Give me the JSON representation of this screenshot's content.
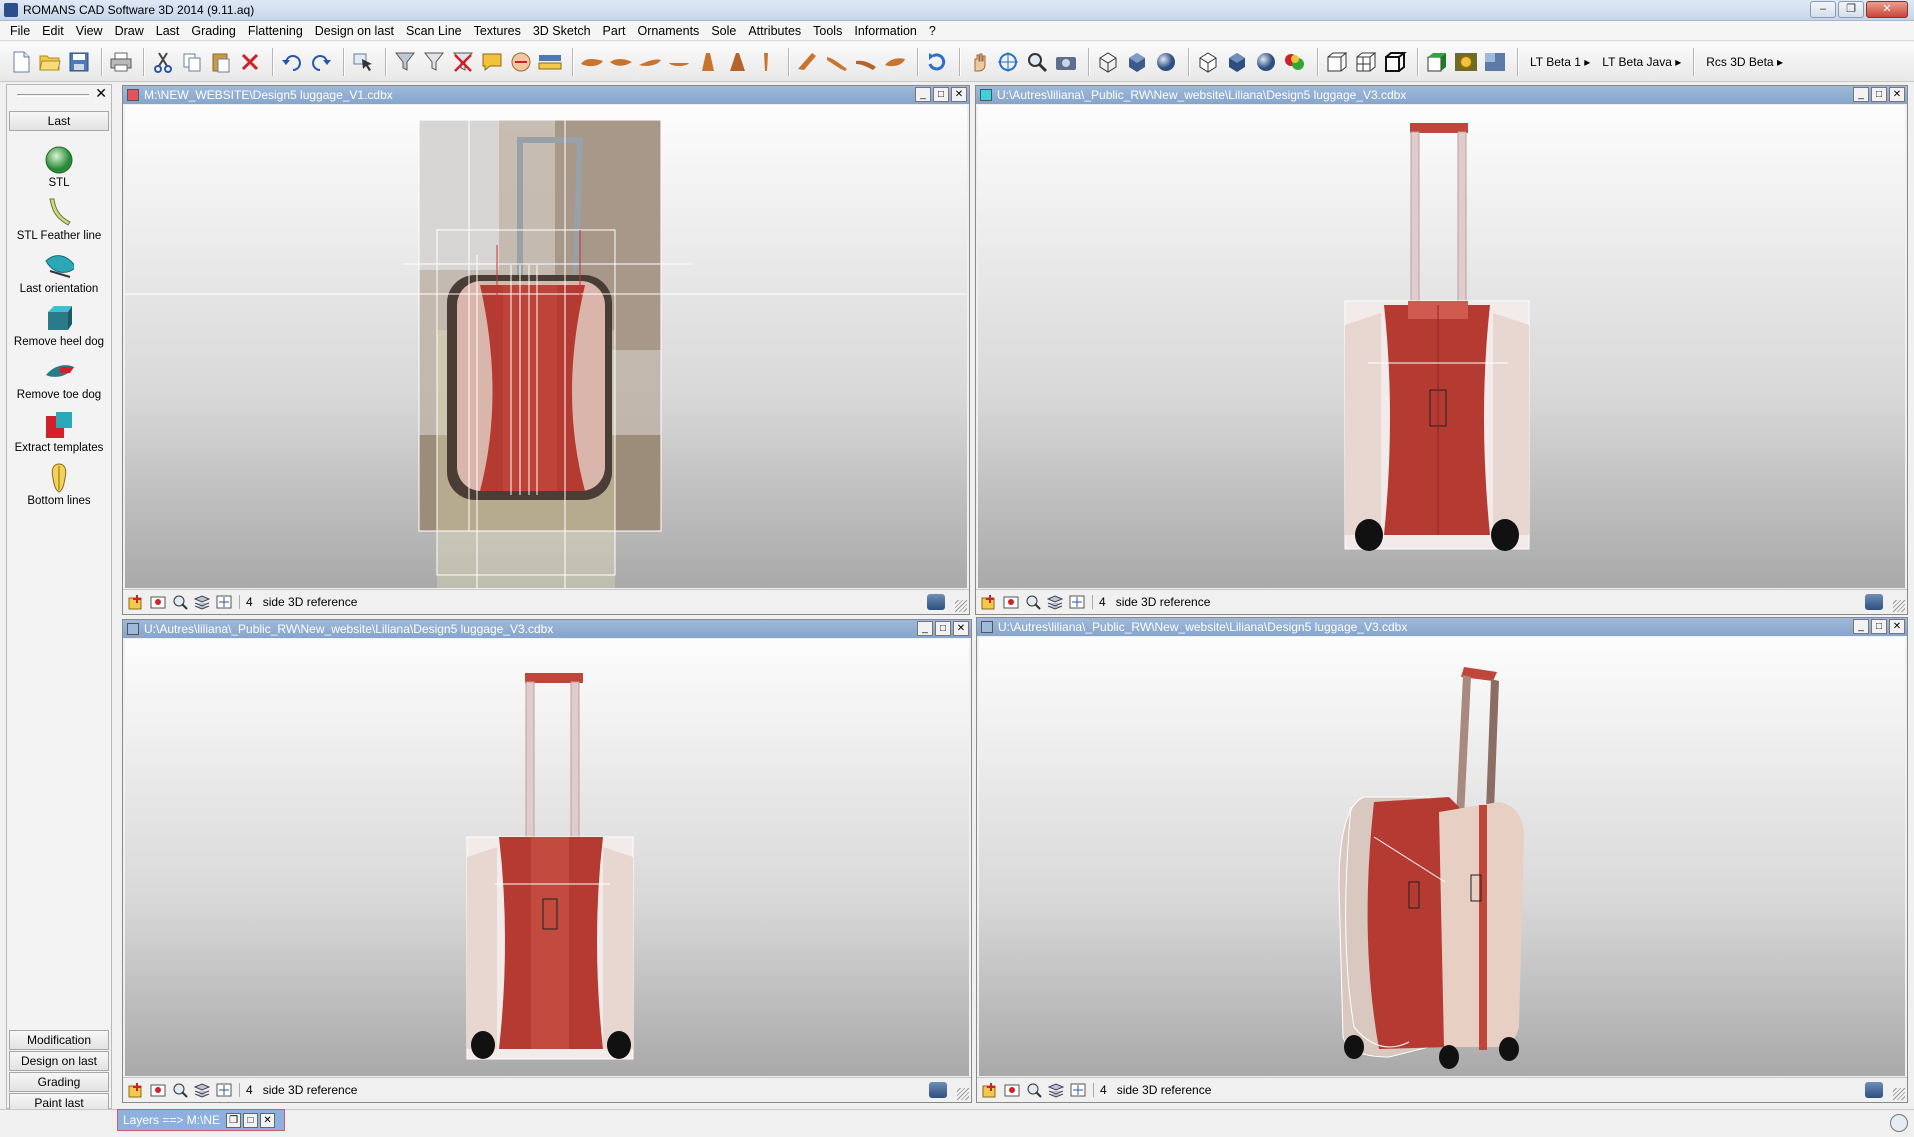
{
  "window": {
    "title": "ROMANS CAD Software 3D 2014 (9.11.aq)",
    "controls": [
      "minimize",
      "maximize",
      "close"
    ]
  },
  "menu": [
    "File",
    "Edit",
    "View",
    "Draw",
    "Last",
    "Grading",
    "Flattening",
    "Design on last",
    "Scan Line",
    "Textures",
    "3D Sketch",
    "Part",
    "Ornaments",
    "Sole",
    "Attributes",
    "Tools",
    "Information",
    "?"
  ],
  "toolbar": {
    "text_buttons": [
      "LT Beta 1 ▸",
      "LT Beta Java ▸",
      "Rcs 3D Beta ▸"
    ],
    "icons": [
      "new-file-icon",
      "open-folder-icon",
      "save-icon",
      "print-icon",
      "cut-icon",
      "copy-icon",
      "paste-icon",
      "delete-icon",
      "undo-icon",
      "redo-icon",
      "select-icon",
      "filter-icon",
      "filter-edit-icon",
      "filter-delete-icon",
      "comment-icon",
      "hand-mark-icon",
      "ruler-icon",
      "last-shape-1-icon",
      "last-shape-2-icon",
      "last-shape-3-icon",
      "last-shape-4-icon",
      "heel-1-icon",
      "heel-2-icon",
      "heel-3-icon",
      "shoe-1-icon",
      "shoe-2-icon",
      "shoe-3-icon",
      "shoe-4-icon",
      "rotate-icon",
      "pan-icon",
      "orbit-icon",
      "zoom-icon",
      "camera-icon",
      "wireframe-cube-icon",
      "solid-cube-icon",
      "sphere-icon",
      "wire-box-icon",
      "shaded-box-icon",
      "shaded-sphere-icon",
      "color-balls-icon",
      "view-front-icon",
      "view-grid-icon",
      "view-box-icon",
      "view-green-icon",
      "gear-render-icon",
      "render-square-icon"
    ]
  },
  "left_panel": {
    "active_tab": "Last",
    "items": [
      {
        "label": "STL",
        "icon": "stl-sphere-icon"
      },
      {
        "label": "STL Feather line",
        "icon": "feather-line-icon"
      },
      {
        "label": "Last orientation",
        "icon": "last-orientation-icon"
      },
      {
        "label": "Remove heel dog",
        "icon": "remove-heel-dog-icon"
      },
      {
        "label": "Remove toe dog",
        "icon": "remove-toe-dog-icon"
      },
      {
        "label": "Extract templates",
        "icon": "extract-templates-icon"
      },
      {
        "label": "Bottom lines",
        "icon": "bottom-lines-icon"
      }
    ],
    "bottom_tabs": [
      "Modification",
      "Design on last",
      "Grading",
      "Paint last"
    ]
  },
  "viewports": [
    {
      "path": "M:\\NEW_WEBSITE\\Design5 luggage_V1.cdbx",
      "layer": "4",
      "reference": "side 3D reference",
      "title_square_color": "#e8505a"
    },
    {
      "path": "U:\\Autres\\liliana\\_Public_RW\\New_website\\Liliana\\Design5 luggage_V3.cdbx",
      "layer": "4",
      "reference": "side 3D reference",
      "title_square_color": "#3fd0e0"
    },
    {
      "path": "U:\\Autres\\liliana\\_Public_RW\\New_website\\Liliana\\Design5 luggage_V3.cdbx",
      "layer": "4",
      "reference": "side 3D reference",
      "title_square_color": "#9eb9d9"
    },
    {
      "path": "U:\\Autres\\liliana\\_Public_RW\\New_website\\Liliana\\Design5 luggage_V3.cdbx",
      "layer": "4",
      "reference": "side 3D reference",
      "title_square_color": "#9eb9d9"
    }
  ],
  "layers_tab": {
    "label": "Layers ==> M:\\NE"
  },
  "colors": {
    "accent": "#86a5cd",
    "luggage_red": "#b53a32",
    "luggage_shell": "#e7cfc4"
  }
}
